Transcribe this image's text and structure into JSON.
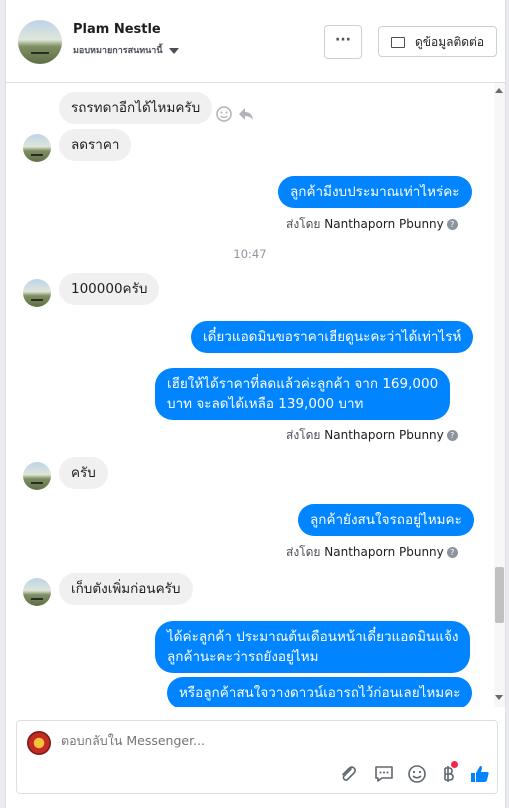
{
  "header": {
    "name": "Plam Nestle",
    "subtitle": "มอบหมายการสนทนานี้",
    "more_label": "···",
    "contact_label": "ดูข้อมูลติดต่อ"
  },
  "messages": {
    "m1": "รถรทดาอีกได้ไหมครับ",
    "m2": "ลดราคา",
    "m3": "ลูกค้ามีงบประมาณเท่าไหร่คะ",
    "sentby_prefix": "ส่งโดย",
    "agent": "Nanthaporn Pbunny",
    "time": "10:47",
    "m4": "100000ครับ",
    "m5": "เดี๋ยวแอดมินขอราคาเฮียดูนะคะว่าได้เท่าไรห์",
    "m6_line1": "เฮียให้ได้ราคาที่ลดแล้วค่ะลูกค้า จาก 169,000",
    "m6_line2": "บาท จะลดได้เหลือ 139,000 บาท",
    "m7": "ครับ",
    "m8": "ลูกค้ายังสนใจรถอยู่ไหมคะ",
    "m9": "เก็บตังเพิ่มก่อนครับ",
    "m10_line1": "ได้ค่ะลูกค้า ประมาณต้นเดือนหน้าเดี๋ยวแอดมินแจ้ง",
    "m10_line2": "ลูกค้านะคะว่ารถยังอยู่ไหม",
    "m11": "หรือลูกค้าสนใจวางดาวน์เอารถไว้ก่อนเลยไหมคะ"
  },
  "composer": {
    "placeholder": "ตอบกลับใน Messenger..."
  },
  "icons": {
    "attach": "paperclip-icon",
    "sticker": "chat-bubble-icon",
    "emoji": "smiley-icon",
    "payment": "baht-icon",
    "like": "thumbs-up-icon"
  },
  "colors": {
    "outgoing": "#0084ff",
    "incoming": "#f1f0f0",
    "like": "#0084ff",
    "notification": "#f02849"
  }
}
